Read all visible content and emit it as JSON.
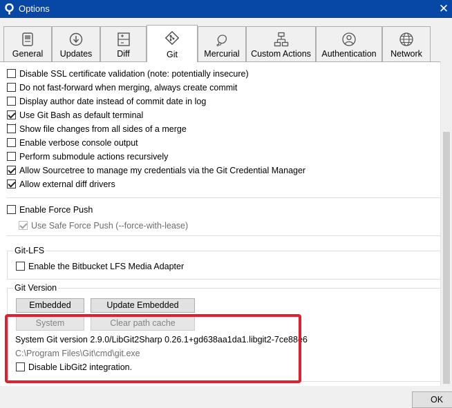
{
  "window": {
    "title": "Options",
    "close_glyph": "✕"
  },
  "tabs": [
    {
      "label": "General",
      "icon": "general-icon",
      "active": false
    },
    {
      "label": "Updates",
      "icon": "updates-icon",
      "active": false
    },
    {
      "label": "Diff",
      "icon": "diff-icon",
      "active": false
    },
    {
      "label": "Git",
      "icon": "git-icon",
      "active": true
    },
    {
      "label": "Mercurial",
      "icon": "mercurial-icon",
      "active": false
    },
    {
      "label": "Custom Actions",
      "icon": "custom-actions-icon",
      "active": false
    },
    {
      "label": "Authentication",
      "icon": "authentication-icon",
      "active": false
    },
    {
      "label": "Network",
      "icon": "network-icon",
      "active": false
    }
  ],
  "options": [
    {
      "label": "Disable SSL certificate validation (note: potentially insecure)",
      "checked": false
    },
    {
      "label": "Do not fast-forward when merging, always create commit",
      "checked": false
    },
    {
      "label": "Display author date instead of commit date in log",
      "checked": false
    },
    {
      "label": "Use Git Bash as default terminal",
      "checked": true
    },
    {
      "label": "Show file changes from all sides of a merge",
      "checked": false
    },
    {
      "label": "Enable verbose console output",
      "checked": false
    },
    {
      "label": "Perform submodule actions recursively",
      "checked": false
    },
    {
      "label": "Allow Sourcetree to manage my credentials via the Git Credential Manager",
      "checked": true
    },
    {
      "label": "Allow external diff drivers",
      "checked": true
    }
  ],
  "force_push": {
    "label": "Enable Force Push",
    "checked": false,
    "safe_label": "Use Safe Force Push (--force-with-lease)",
    "safe_checked": true
  },
  "git_lfs": {
    "group_label": "Git-LFS",
    "option_label": "Enable the Bitbucket LFS Media Adapter",
    "checked": false
  },
  "git_version": {
    "group_label": "Git Version",
    "embedded_button": "Embedded",
    "update_embedded_button": "Update Embedded",
    "system_button": "System",
    "clear_path_cache_button": "Clear path cache",
    "version_text": "System Git version 2.9.0/LibGit2Sharp 0.26.1+gd638aa1da1.libgit2-7ce88e6",
    "path_text": "C:\\Program Files\\Git\\cmd\\git.exe",
    "disable_libgit2_label": "Disable LibGit2 integration.",
    "disable_libgit2_checked": false
  },
  "footer": {
    "ok_button": "OK"
  },
  "colors": {
    "titlebar": "#0747a6",
    "highlight": "#e0202e"
  }
}
